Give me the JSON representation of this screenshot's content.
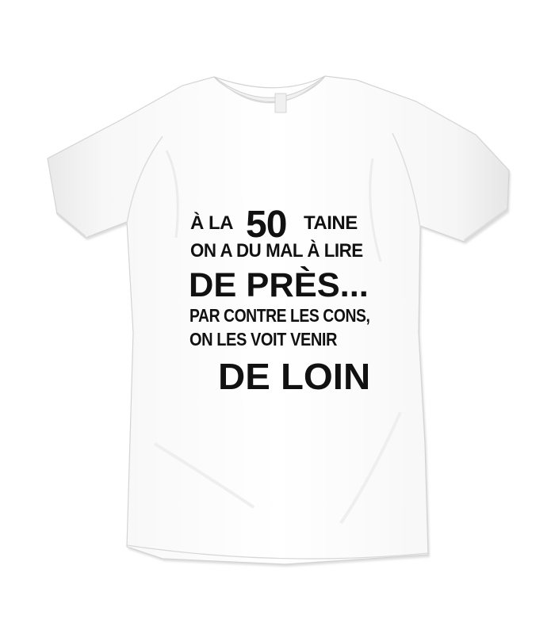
{
  "product": {
    "garment_color": "#ffffff",
    "print_color": "#111111"
  },
  "print": {
    "line1_a": "À LA",
    "line1_number": "50",
    "line1_b": "TAINE",
    "line2": "ON A DU MAL À LIRE",
    "line3": "DE PRÈS...",
    "line4": "PAR CONTRE LES CONS,",
    "line5": "ON LES VOIT VENIR",
    "line6": "DE LOIN"
  }
}
